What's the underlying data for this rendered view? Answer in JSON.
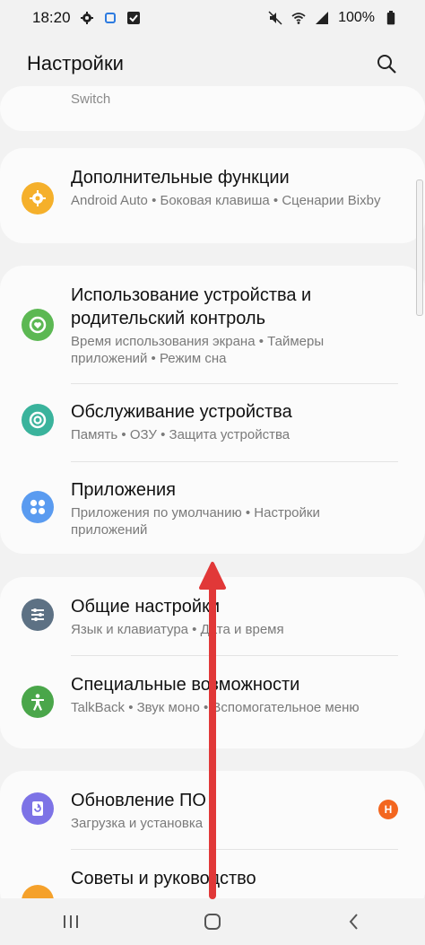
{
  "status": {
    "time": "18:20",
    "battery": "100%"
  },
  "header": {
    "title": "Настройки"
  },
  "partial_top": {
    "text": "Switch"
  },
  "card1": {
    "items": [
      {
        "title": "Дополнительные функции",
        "sub": "Android Auto  •  Боковая клавиша  •  Сценарии Bixby",
        "icon": "puzzle-gear-icon",
        "color": "#f5b02b"
      }
    ]
  },
  "card2": {
    "items": [
      {
        "title": "Использование устройства и родительский контроль",
        "sub": "Время использования экрана  •  Таймеры приложений  •  Режим сна",
        "icon": "wellbeing-icon",
        "color": "#5cb853"
      },
      {
        "title": "Обслуживание устройства",
        "sub": "Память  •  ОЗУ  •  Защита устройства",
        "icon": "device-care-icon",
        "color": "#3ab39c"
      },
      {
        "title": "Приложения",
        "sub": "Приложения по умолчанию  •  Настройки приложений",
        "icon": "apps-icon",
        "color": "#5a9bf0"
      }
    ]
  },
  "card3": {
    "items": [
      {
        "title": "Общие настройки",
        "sub": "Язык и клавиатура  •  Дата и время",
        "icon": "sliders-icon",
        "color": "#5d7184"
      },
      {
        "title": "Специальные возможности",
        "sub": "TalkBack  •  Звук моно  •  Вспомогательное меню",
        "icon": "accessibility-icon",
        "color": "#4aa64a"
      }
    ]
  },
  "card4": {
    "items": [
      {
        "title": "Обновление ПО",
        "sub": "Загрузка и установка",
        "icon": "software-update-icon",
        "color": "#7d73e6",
        "badge": "Н"
      },
      {
        "title": "Советы и руководство",
        "icon": "tips-icon",
        "color": "#f5a12b"
      }
    ]
  }
}
